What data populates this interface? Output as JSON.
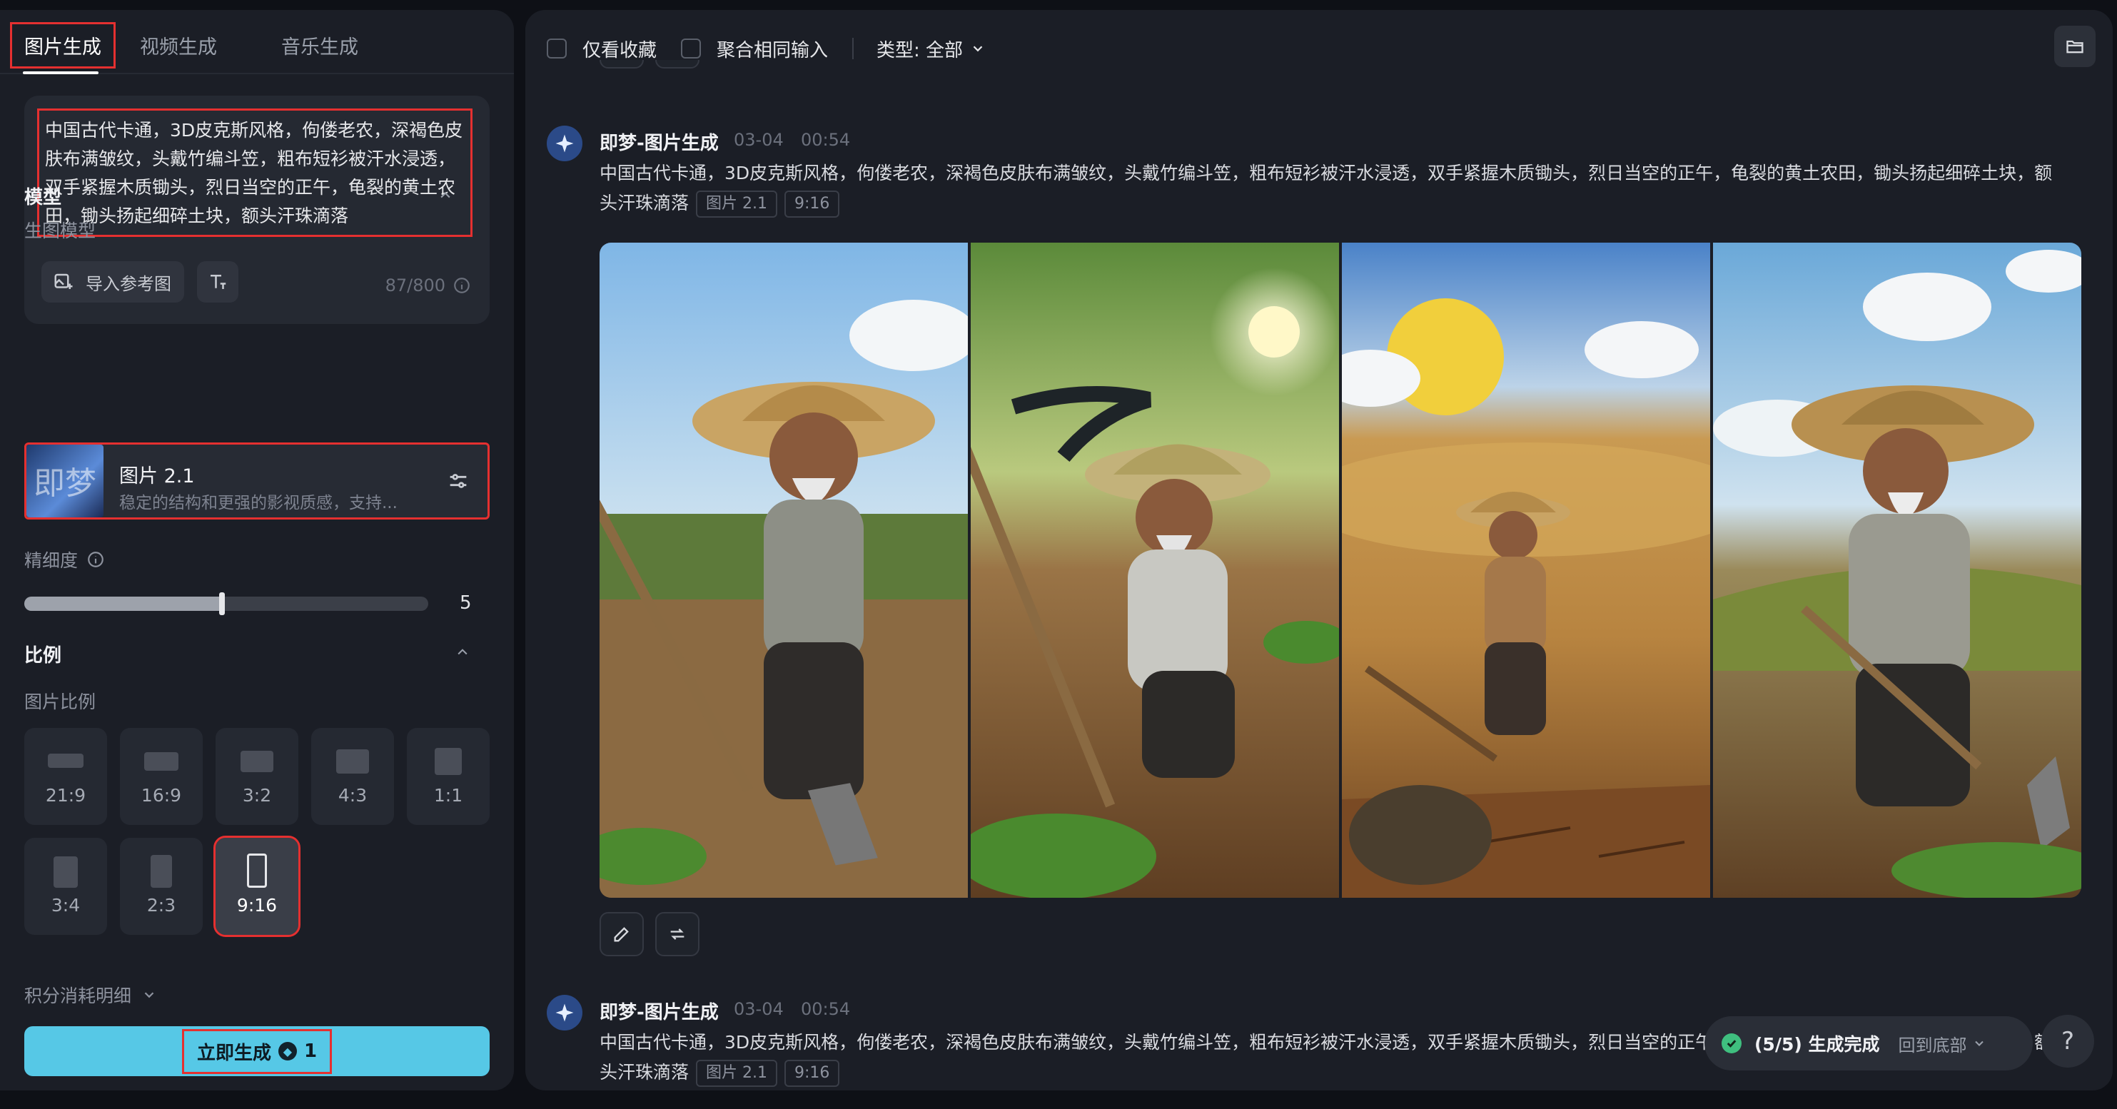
{
  "tabs": [
    "图片生成",
    "视频生成",
    "音乐生成"
  ],
  "prompt": {
    "text": "中国古代卡通，3D皮克斯风格，佝偻老农，深褐色皮肤布满皱纹，头戴竹编斗笠，粗布短衫被汗水浸透，双手紧握木质锄头，烈日当空的正午，龟裂的黄土农田，锄头扬起细碎土块，额头汗珠滴落",
    "ref_button": "导入参考图",
    "counter": "87/800"
  },
  "model": {
    "section_title": "模型",
    "sublabel": "生图模型",
    "thumb_text": "即梦",
    "name": "图片 2.1",
    "desc": "稳定的结构和更强的影视质感，支持..."
  },
  "fineness": {
    "label": "精细度",
    "value": "5",
    "level": 0.49
  },
  "ratio": {
    "section_title": "比例",
    "sublabel": "图片比例",
    "options": [
      "21:9",
      "16:9",
      "3:2",
      "4:3",
      "1:1",
      "3:4",
      "2:3",
      "9:16"
    ],
    "selected": "9:16"
  },
  "cost_label": "积分消耗明细",
  "generate": {
    "label": "立即生成",
    "cost": "1"
  },
  "topbar": {
    "favorites": "仅看收藏",
    "merge": "聚合相同输入",
    "type": "类型: 全部"
  },
  "messages": [
    {
      "title": "即梦-图片生成",
      "date": "03-04",
      "time": "00:54",
      "text": "中国古代卡通，3D皮克斯风格，佝偻老农，深褐色皮肤布满皱纹，头戴竹编斗笠，粗布短衫被汗水浸透，双手紧握木质锄头，烈日当空的正午，龟裂的黄土农田，锄头扬起细碎土块，额头汗珠滴落",
      "model_tag": "图片 2.1",
      "ratio_tag": "9:16"
    },
    {
      "title": "即梦-图片生成",
      "date": "03-04",
      "time": "00:54",
      "text": "中国古代卡通，3D皮克斯风格，佝偻老农，深褐色皮肤布满皱纹，头戴竹编斗笠，粗布短衫被汗水浸透，双手紧握木质锄头，烈日当空的正午，龟裂的黄土农田，锄头扬起细碎土块，额头汗珠滴落",
      "model_tag": "图片 2.1",
      "ratio_tag": "9:16"
    }
  ],
  "toast": {
    "status": "(5/5) 生成完成",
    "back": "回到底部"
  },
  "help": "?",
  "colors": {
    "accent": "#56c8e6",
    "highlight_box": "#e53030",
    "panel": "#1b1e26",
    "success": "#3fbf7f"
  }
}
